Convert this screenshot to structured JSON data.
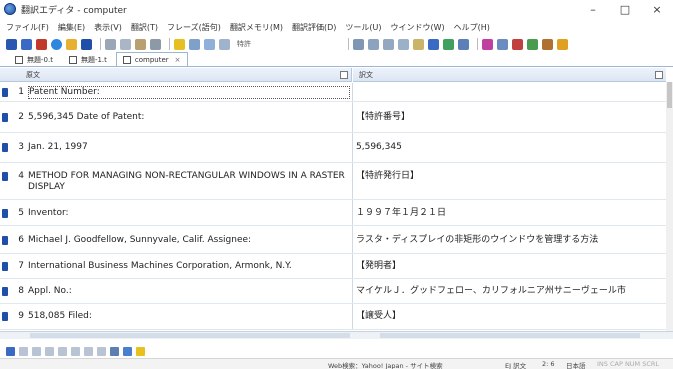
{
  "window": {
    "title": "翻訳エディタ - computer",
    "controls": [
      "–",
      "□",
      "×"
    ]
  },
  "menu": {
    "items": [
      "ファイル(F)",
      "編集(E)",
      "表示(V)",
      "翻訳(T)",
      "フレーズ(語句)",
      "翻訳メモリ(M)",
      "翻訳評価(D)",
      "ツール(U)",
      "ウインドウ(W)",
      "ヘルプ(H)"
    ]
  },
  "toolbar": {
    "search_label": "特許"
  },
  "tabs": [
    {
      "label": "無題-0.t",
      "active": false
    },
    {
      "label": "無題-1.t",
      "active": false
    },
    {
      "label": "computer",
      "active": true
    }
  ],
  "columns": {
    "source": "原文",
    "target": "訳文"
  },
  "rows": [
    {
      "n": "1",
      "src": "Patent Number:",
      "tgt": ""
    },
    {
      "n": "2",
      "src": "5,596,345 Date of Patent:",
      "tgt": "【特許番号】"
    },
    {
      "n": "3",
      "src": "Jan. 21, 1997",
      "tgt": "5,596,345"
    },
    {
      "n": "4",
      "src": "METHOD FOR MANAGING NON-RECTANGULAR WINDOWS IN A RASTER DISPLAY",
      "tgt": "【特許発行日】"
    },
    {
      "n": "5",
      "src": "Inventor:",
      "tgt": "１９９７年１月２１日"
    },
    {
      "n": "6",
      "src": "Michael J. Goodfellow, Sunnyvale, Calif. Assignee:",
      "tgt": "ラスタ・ディスプレイの非矩形のウインドウを管理する方法"
    },
    {
      "n": "7",
      "src": "International Business Machines Corporation, Armonk, N.Y.",
      "tgt": "【発明者】"
    },
    {
      "n": "8",
      "src": "Appl. No.:",
      "tgt": "マイケルＪ．グッドフェロー、カリフォルニア州サニーヴェール市"
    },
    {
      "n": "9",
      "src": "518,085 Filed:",
      "tgt": "【譲受人】"
    }
  ],
  "status": {
    "web_search": "Web検索：Yahoo! Japan - サイト検索",
    "direction": "EJ 訳文",
    "position": "2: 6",
    "language": "日本語",
    "indicators": "INS CAP NUM SCRL"
  },
  "colors": {
    "accent": "#1f4fa8",
    "header_bg": "#dbe6f3",
    "row_border": "#dfe7ef"
  }
}
